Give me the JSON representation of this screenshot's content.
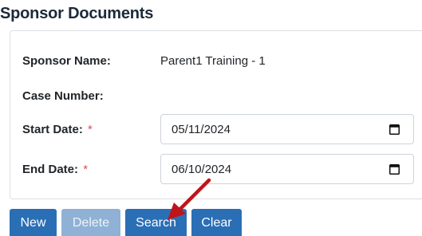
{
  "page": {
    "title": "Sponsor Documents"
  },
  "form": {
    "sponsor_name_label": "Sponsor Name:",
    "sponsor_name_value": "Parent1 Training - 1",
    "case_number_label": "Case Number:",
    "start_date_label": "Start Date:",
    "start_date_value": "05/11/2024",
    "end_date_label": "End Date:",
    "end_date_value": "06/10/2024",
    "required_marker": "*"
  },
  "buttons": {
    "new_label": "New",
    "delete_label": "Delete",
    "search_label": "Search",
    "clear_label": "Clear"
  },
  "annotation": {
    "arrow_color": "#c0141b"
  },
  "colors": {
    "primary": "#2a6fb5",
    "disabled": "#8fb1d6",
    "required": "#d9534f"
  }
}
